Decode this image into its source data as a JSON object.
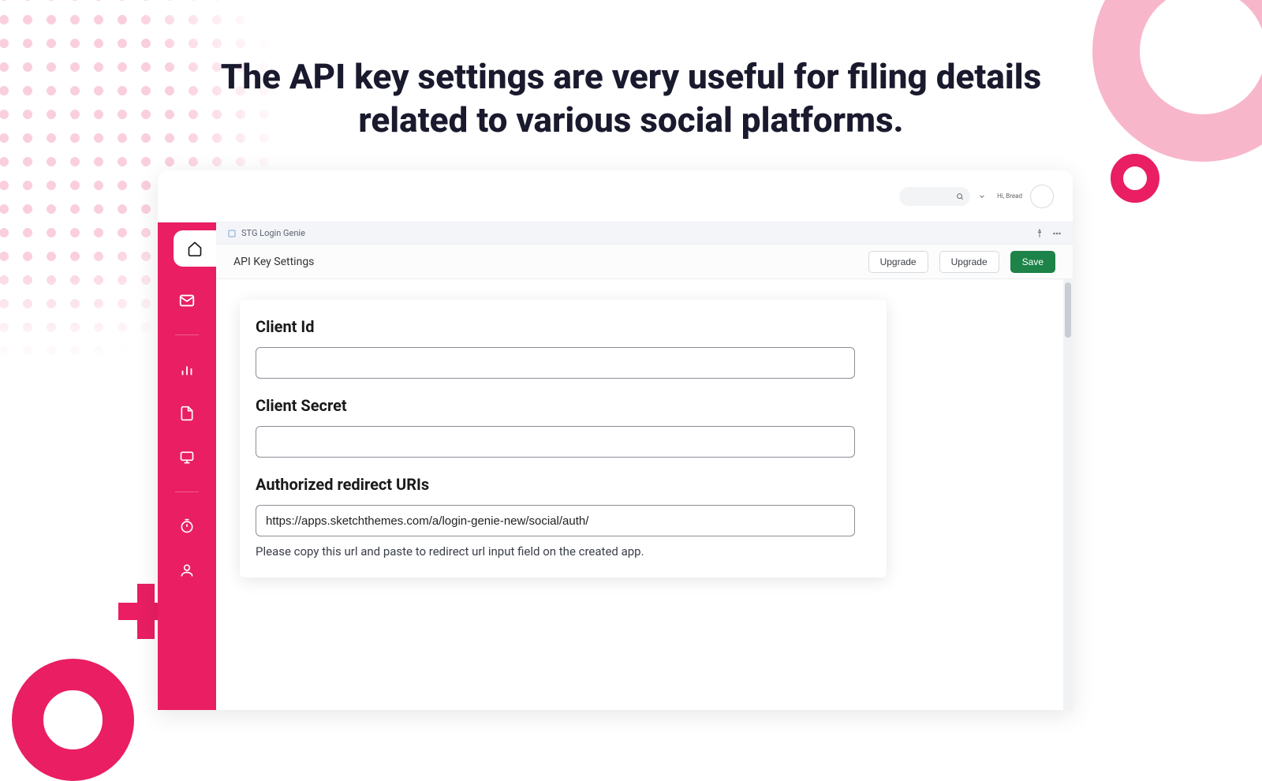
{
  "headline": "The API key settings are very useful for filing details related to various social platforms.",
  "topbar": {
    "greeting": "Hi, Bread"
  },
  "breadcrumb": {
    "app_name": "STG Login Genie"
  },
  "section": {
    "title": "API Key Settings",
    "upgrade_btn_small": "Upgrade",
    "upgrade_btn": "Upgrade",
    "save_btn": "Save"
  },
  "form": {
    "client_id_label": "Client Id",
    "client_id_value": "",
    "client_secret_label": "Client Secret",
    "client_secret_value": "",
    "redirect_label": "Authorized redirect URIs",
    "redirect_value": "https://apps.sketchthemes.com/a/login-genie-new/social/auth/",
    "redirect_help": "Please copy this url and paste to redirect url input field on the created app."
  },
  "colors": {
    "brand_pink": "#e91e63",
    "pink_light": "#f8b6cb",
    "save_green": "#1d8348"
  }
}
